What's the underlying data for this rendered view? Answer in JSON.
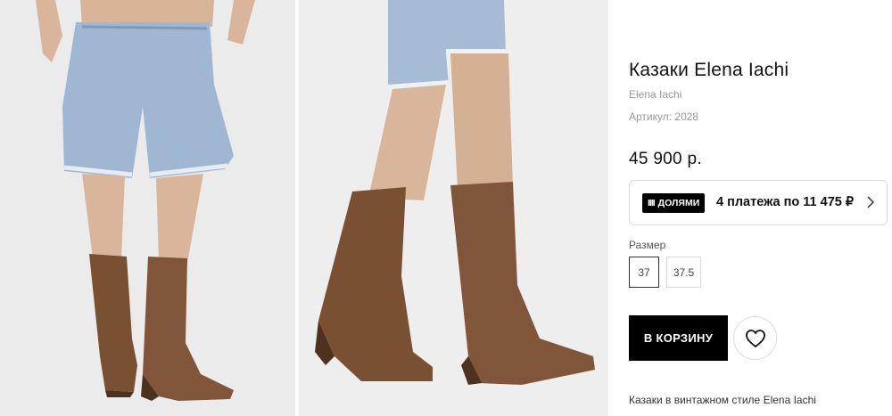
{
  "product": {
    "title": "Казаки Elena Iachi",
    "brand": "Elena Iachi",
    "sku": "Артикул: 2028",
    "price": "45 900 р.",
    "description": "Казаки в винтажном стиле Elena Iachi"
  },
  "installments": {
    "badge_label": "ДОЛЯМИ",
    "badge_bars": "IIII",
    "text": "4 платежа по 11 475 ₽",
    "chevron_icon": "chevron-right-icon"
  },
  "sizes": {
    "label": "Размер",
    "options": [
      "37",
      "37.5"
    ],
    "selected": "37"
  },
  "actions": {
    "cart_label": "В КОРЗИНУ",
    "favorite_icon": "heart-icon"
  },
  "colors": {
    "background": "#ffffff",
    "primary_button": "#000000",
    "border": "#dcdcdc",
    "muted_text": "#9a9a9a",
    "boot_suede": "#7a5032",
    "denim": "#9fb7d3"
  }
}
